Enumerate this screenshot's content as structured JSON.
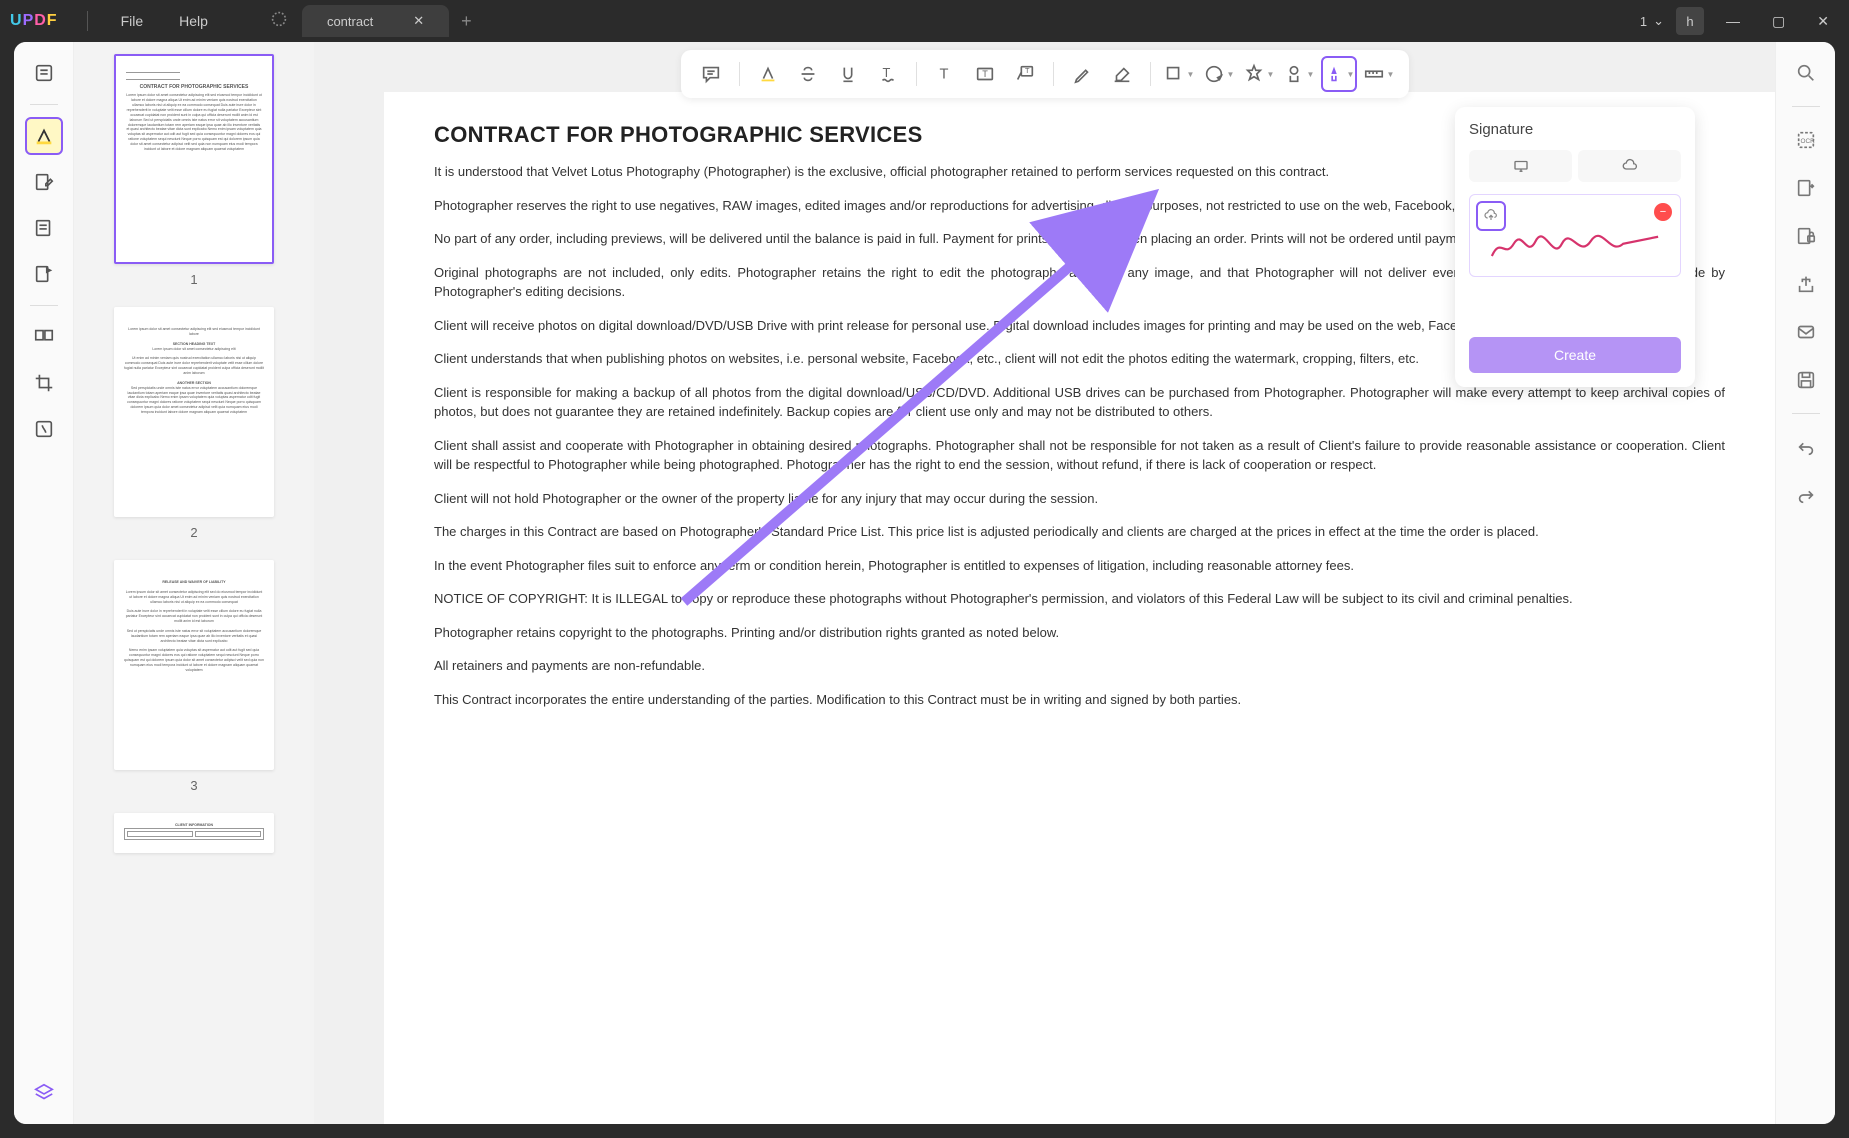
{
  "app": {
    "logo": {
      "u": "U",
      "p": "P",
      "d": "D",
      "f": "F"
    },
    "menus": {
      "file": "File",
      "help": "Help"
    },
    "tab_name": "contract",
    "page_num": "1",
    "user_initial": "h"
  },
  "thumbnails": {
    "pages": [
      "1",
      "2",
      "3"
    ]
  },
  "signature_panel": {
    "title": "Signature",
    "create": "Create"
  },
  "document": {
    "heading": "CONTRACT FOR PHOTOGRAPHIC SERVICES",
    "p1": "It is understood that Velvet Lotus Photography (Photographer) is the exclusive, official photographer retained to perform services requested on this contract.",
    "p2": "Photographer reserves the right to use negatives, RAW images, edited images and/or reproductions for advertising, display purposes, not restricted to use on the web, Facebook, business cards, or posters.",
    "p3": "No part of any order, including previews, will be delivered until the balance is paid in full. Payment for prints is required when placing an order. Prints will not be ordered until payment is made.",
    "p4": "Original photographs are not included, only edits. Photographer retains the right to edit the photographs and omit any image, and that Photographer will not deliver every exposure taken. Client agrees to abide by Photographer's editing decisions.",
    "p5": "Client will receive photos on digital download/DVD/USB Drive with print release for personal use. Digital download includes images for printing and may be used on the web, Facebook, or email.",
    "p6": "Client understands that when publishing photos on websites, i.e. personal website, Facebook, etc., client will not edit the photos editing the watermark, cropping, filters, etc.",
    "p7": "Client is responsible for making a backup of all photos from the digital download/USB/CD/DVD. Additional USB drives can be purchased from Photographer. Photographer will make every attempt to keep archival copies of photos, but does not guarantee they are retained indefinitely. Backup copies are for client use only and may not be distributed to others.",
    "p8": "Client shall assist and cooperate with Photographer in obtaining desired photographs. Photographer shall not be responsible for not taken as a result of Client's failure to provide reasonable assistance or cooperation. Client will be respectful to Photographer while being photographed. Photographer has the right to end the session, without refund, if there is lack of cooperation or respect.",
    "p9": "Client will not hold Photographer or the owner of the property liable for any injury that may occur during the session.",
    "p10": "The charges in this Contract are based on Photographer's Standard Price List. This price list is adjusted periodically and clients are charged at the prices in effect at the time the order is placed.",
    "p11": "In the event Photographer files suit to enforce any term or condition herein, Photographer is entitled to expenses of litigation, including reasonable attorney fees.",
    "p12": "NOTICE OF COPYRIGHT: It is ILLEGAL to copy or reproduce these photographs without Photographer's permission, and violators of this Federal Law will be subject to its civil and criminal penalties.",
    "p13": "Photographer retains copyright to the photographs. Printing and/or distribution rights granted as noted below.",
    "p14": "All retainers and payments are non-refundable.",
    "p15": "This Contract incorporates the entire understanding of the parties. Modification to this Contract must be in writing and signed by both parties."
  }
}
